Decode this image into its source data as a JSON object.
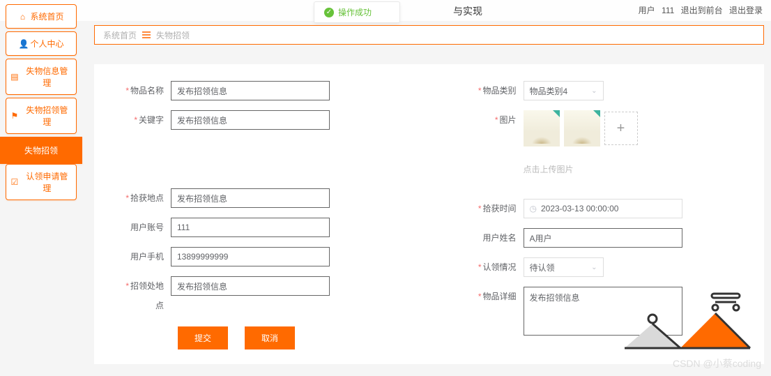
{
  "header": {
    "title_fragment": "与实现",
    "user_label": "用户",
    "user_id": "111",
    "back_front": "退出到前台",
    "logout": "退出登录"
  },
  "toast": {
    "text": "操作成功"
  },
  "sidebar": {
    "items": [
      {
        "label": "系统首页",
        "icon": "home-icon"
      },
      {
        "label": "个人中心",
        "icon": "user-icon"
      },
      {
        "label": "失物信息管理",
        "icon": "list-icon"
      },
      {
        "label": "失物招领管理",
        "icon": "flag-icon"
      },
      {
        "label": "失物招领",
        "icon": "",
        "active": true
      },
      {
        "label": "认领申请管理",
        "icon": "check-icon"
      }
    ]
  },
  "breadcrumb": {
    "root": "系统首页",
    "current": "失物招领"
  },
  "form": {
    "left": {
      "item_name": {
        "label": "物品名称",
        "value": "发布招领信息",
        "required": true
      },
      "keyword": {
        "label": "关键字",
        "value": "发布招领信息",
        "required": true
      },
      "pick_place": {
        "label": "拾获地点",
        "value": "发布招领信息",
        "required": true
      },
      "user_acc": {
        "label": "用户账号",
        "value": "111",
        "required": false
      },
      "user_phone": {
        "label": "用户手机",
        "value": "13899999999",
        "required": false
      },
      "claim_place": {
        "label": "招领处地点",
        "value": "发布招领信息",
        "required": true
      }
    },
    "right": {
      "category": {
        "label": "物品类别",
        "value": "物品类别4",
        "required": true
      },
      "images": {
        "label": "图片",
        "hint": "点击上传图片",
        "required": true
      },
      "pick_time": {
        "label": "拾获时间",
        "value": "2023-03-13 00:00:00",
        "required": true
      },
      "user_name": {
        "label": "用户姓名",
        "value": "A用户",
        "required": false
      },
      "claim_state": {
        "label": "认领情况",
        "value": "待认领",
        "required": true
      },
      "detail": {
        "label": "物品详细",
        "value": "发布招领信息",
        "required": true
      }
    },
    "buttons": {
      "submit": "提交",
      "cancel": "取消"
    }
  },
  "watermark": "CSDN @小蔡coding"
}
